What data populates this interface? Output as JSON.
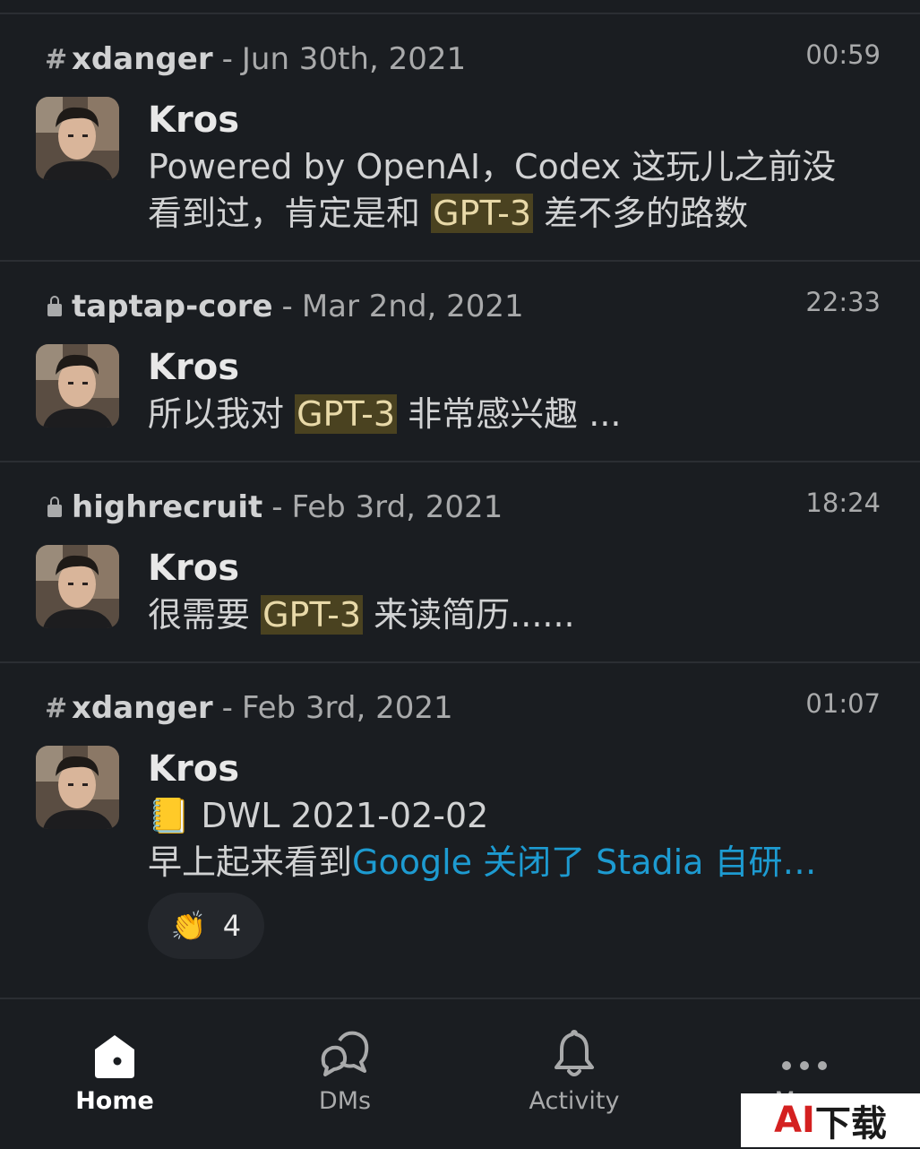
{
  "results": [
    {
      "channel_type": "public",
      "channel": "xdanger",
      "date": "Jun 30th, 2021",
      "time": "00:59",
      "author": "Kros",
      "lines": [
        [
          {
            "t": "Powered by OpenAI，Codex 这玩儿之前没"
          }
        ],
        [
          {
            "t": "看到过，肯定是和 "
          },
          {
            "t": "GPT-3",
            "hl": true
          },
          {
            "t": " 差不多的路数"
          }
        ]
      ]
    },
    {
      "channel_type": "private",
      "channel": "taptap-core",
      "date": "Mar 2nd, 2021",
      "time": "22:33",
      "author": "Kros",
      "lines": [
        [
          {
            "t": "所以我对 "
          },
          {
            "t": "GPT-3",
            "hl": true
          },
          {
            "t": " 非常感兴趣 ..."
          }
        ]
      ]
    },
    {
      "channel_type": "private",
      "channel": "highrecruit",
      "date": "Feb 3rd, 2021",
      "time": "18:24",
      "author": "Kros",
      "lines": [
        [
          {
            "t": "很需要 "
          },
          {
            "t": "GPT-3",
            "hl": true
          },
          {
            "t": " 来读简历......"
          }
        ]
      ]
    },
    {
      "channel_type": "public",
      "channel": "xdanger",
      "date": "Feb 3rd, 2021",
      "time": "01:07",
      "author": "Kros",
      "lines": [
        [
          {
            "t": "📒 DWL 2021-02-02"
          }
        ],
        [
          {
            "t": "早上起来看到"
          },
          {
            "t": "Google 关闭了 Stadia 自研…",
            "link": true
          }
        ]
      ],
      "reaction": {
        "emoji": "👏",
        "count": "4"
      }
    }
  ],
  "nav": {
    "home": "Home",
    "dms": "DMs",
    "activity": "Activity",
    "more": "More"
  },
  "watermark": {
    "ai": "AI",
    "rest": "下载"
  },
  "colors": {
    "highlight": "#4a4220",
    "link": "#1d9bd1",
    "background": "#1a1d21"
  }
}
